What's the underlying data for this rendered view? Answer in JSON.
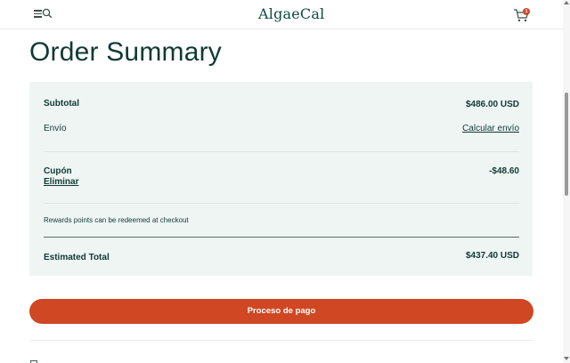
{
  "header": {
    "logo_text": "AlgaeCal",
    "cart_count": "1"
  },
  "page": {
    "title": "Order Summary"
  },
  "summary": {
    "subtotal_label": "Subtotal",
    "subtotal_value": "$486.00 USD",
    "shipping_label": "Envío",
    "shipping_link": "Calcular envío",
    "coupon_label": "Cupón",
    "coupon_remove": "Eliminar",
    "coupon_value": "-$48.60",
    "rewards_note": "Rewards points can be redeemed at checkout",
    "total_label": "Estimated Total",
    "total_value": "$437.40 USD"
  },
  "checkout": {
    "button_label": "Proceso de pago",
    "accent_color": "#d04723"
  },
  "icons": [
    "menu-icon",
    "search-icon",
    "cart-icon"
  ]
}
